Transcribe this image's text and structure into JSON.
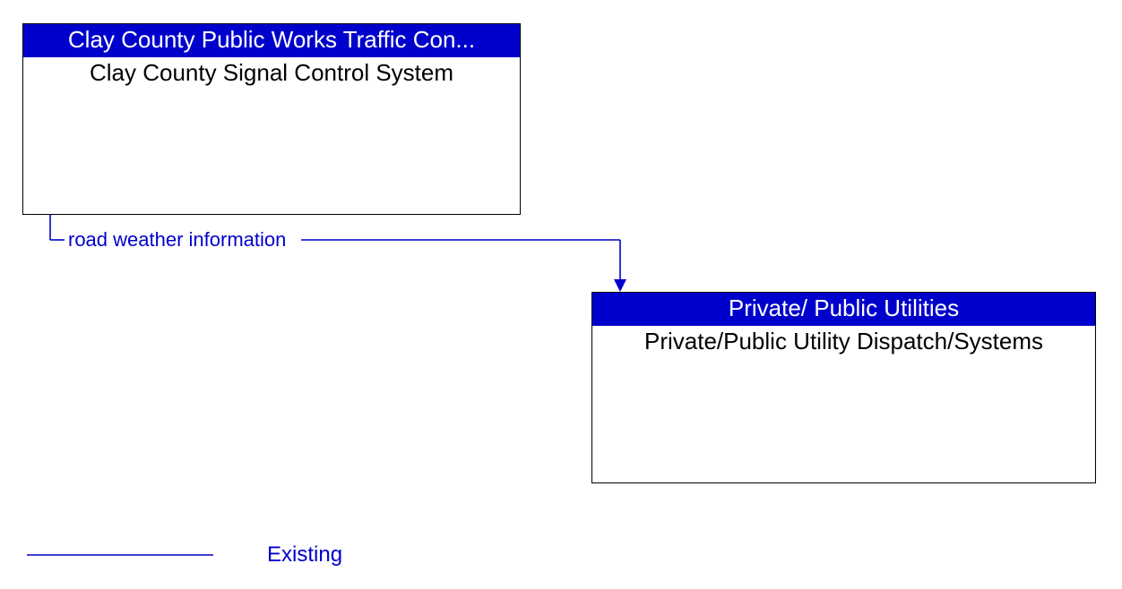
{
  "nodes": {
    "source": {
      "header": "Clay County Public Works Traffic Con...",
      "body": "Clay County Signal Control System"
    },
    "target": {
      "header": "Private/ Public Utilities",
      "body": "Private/Public Utility Dispatch/Systems"
    }
  },
  "flow": {
    "label": "road weather information"
  },
  "legend": {
    "existing": "Existing"
  },
  "colors": {
    "header_bg": "#0000cc",
    "line": "#0000cc"
  }
}
